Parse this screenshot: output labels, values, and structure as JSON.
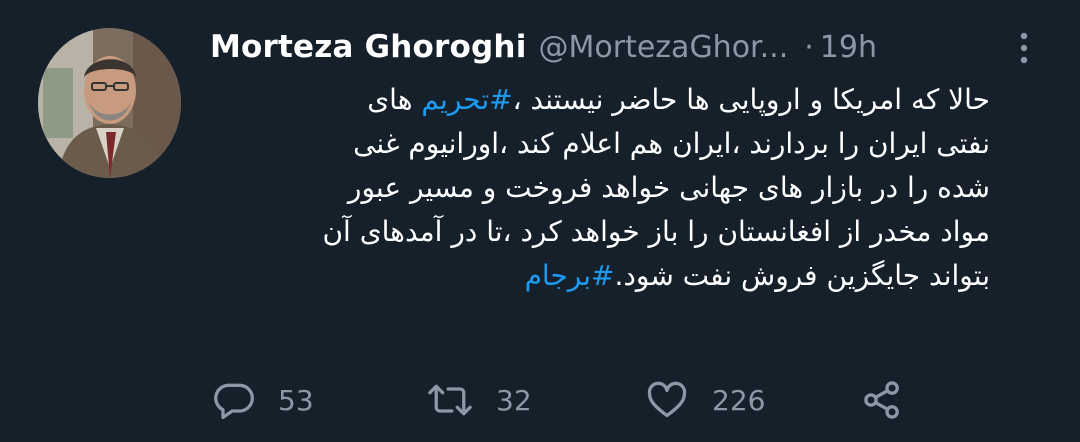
{
  "author": {
    "display_name": "Morteza Ghoroghi",
    "handle": "@MortezaGhor...",
    "separator": "·",
    "time": "19h"
  },
  "tweet": {
    "line1_text": "حالا که امریکا و اروپایی ها حاضر نیستند ،",
    "line1_hashtag": "#تحریم",
    "line1_tail": " های",
    "line2": "نفتی ایران را بردارند ،ایران هم اعلام کند ،اورانیوم غنی",
    "line3": "شده را در بازار های جهانی خواهد فروخت و مسیر عبور",
    "line4": "مواد مخدر از افغانستان را باز خواهد کرد ،تا در آمدهای آن",
    "line6_text": "بتواند جایگزین فروش نفت شود.",
    "line6_hashtag": "#برجام"
  },
  "actions": {
    "reply_count": "53",
    "retweet_count": "32",
    "like_count": "226"
  },
  "icons": {
    "reply": "reply-icon",
    "retweet": "retweet-icon",
    "like": "heart-icon",
    "share": "share-icon",
    "more": "more-vertical-icon"
  },
  "colors": {
    "background": "#15202b",
    "text": "#ffffff",
    "secondary": "#8b98a5",
    "link": "#1d9bf0"
  }
}
